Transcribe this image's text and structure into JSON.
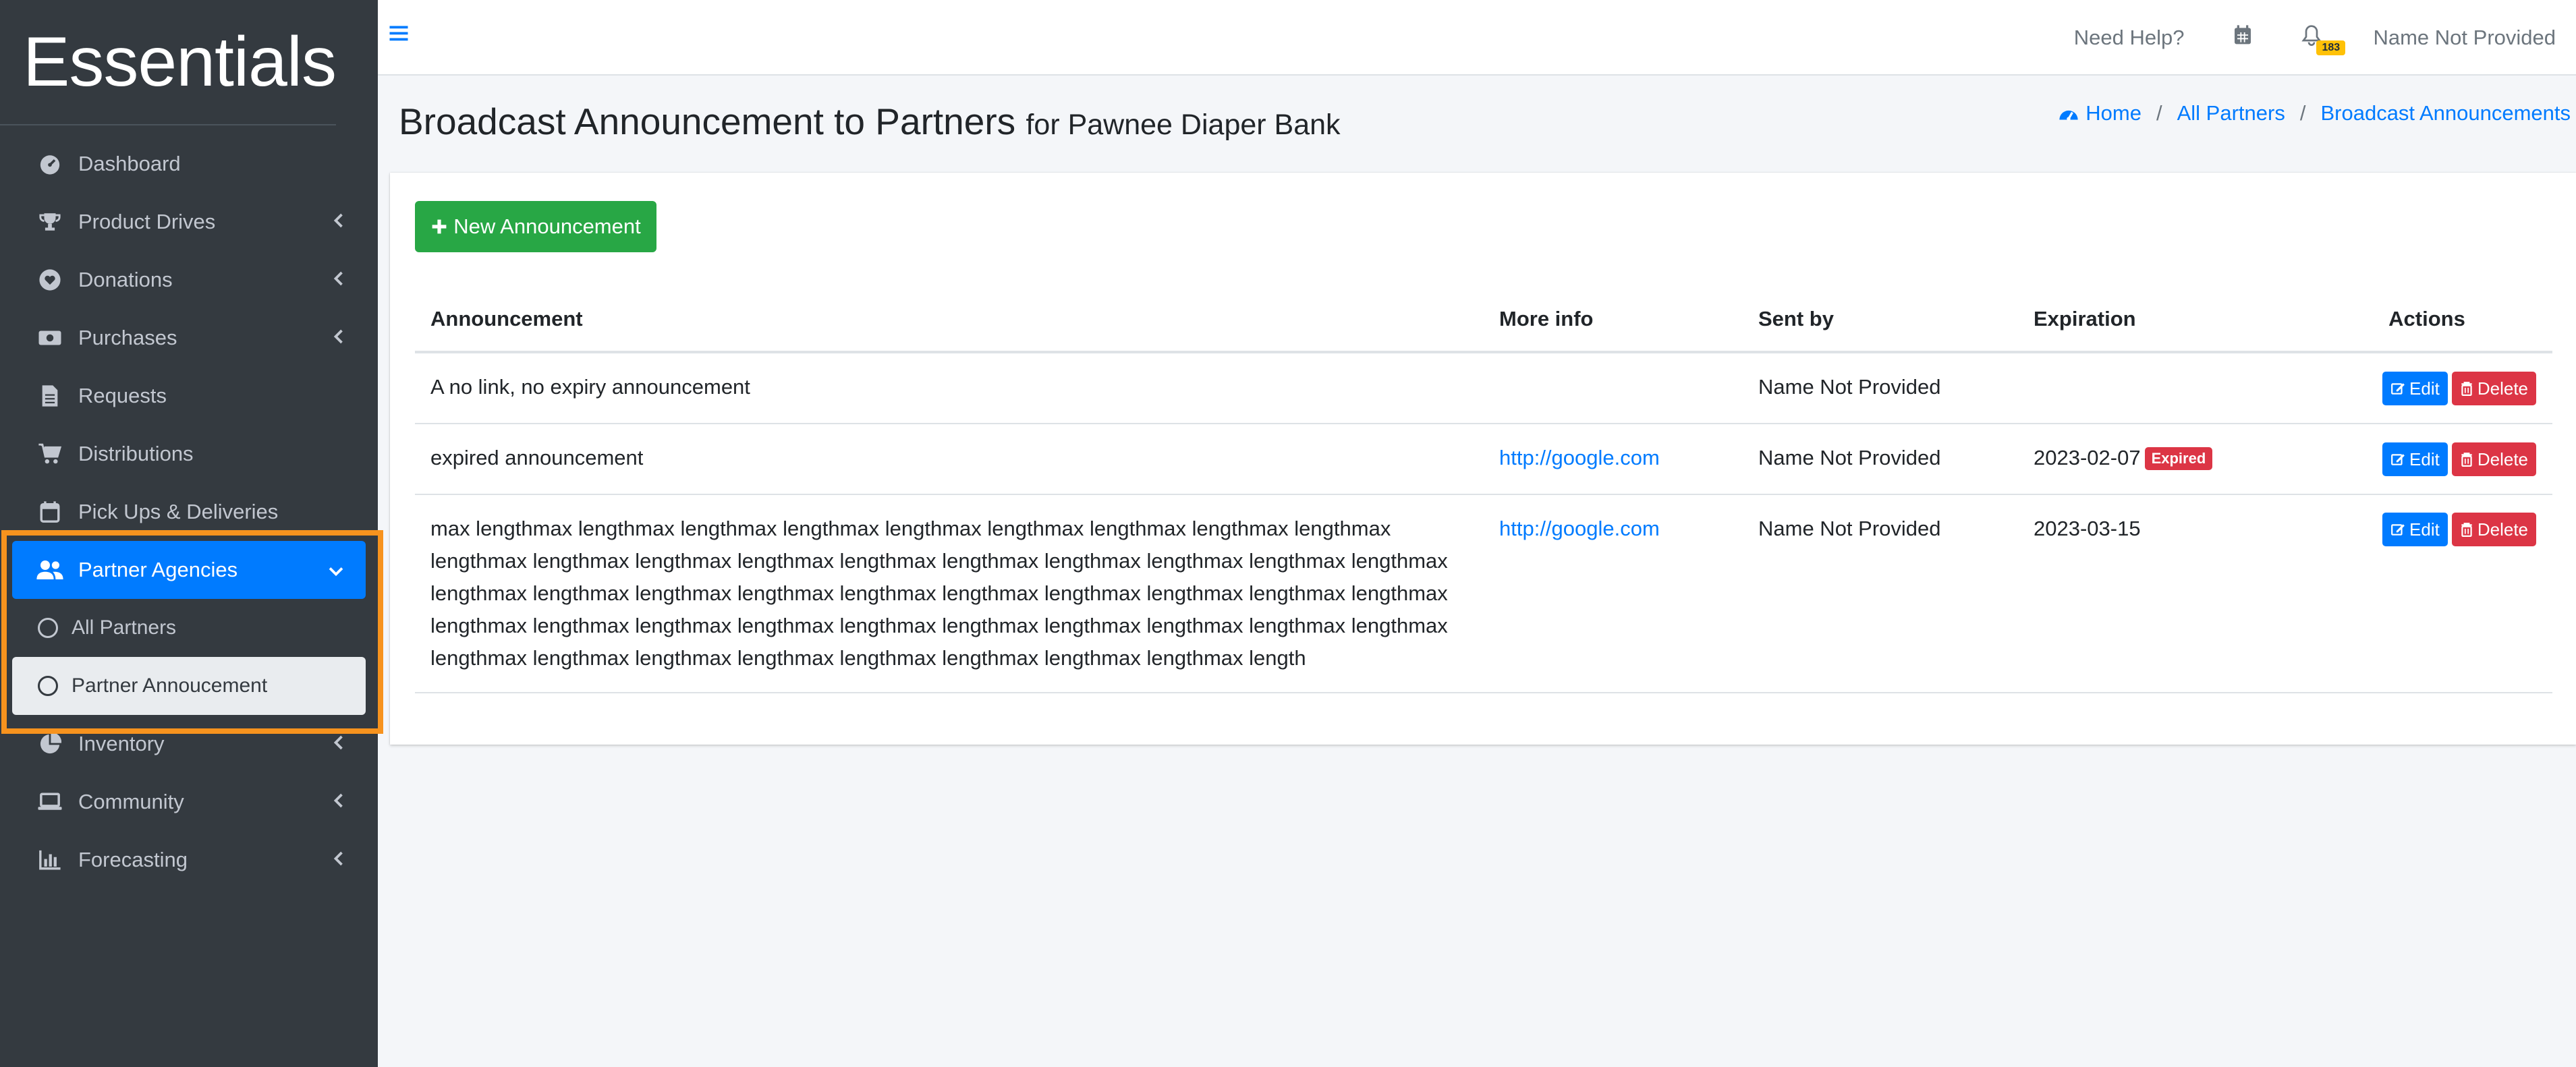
{
  "brand": "Essentials",
  "sidebar": {
    "items": [
      {
        "label": "Dashboard"
      },
      {
        "label": "Product Drives"
      },
      {
        "label": "Donations"
      },
      {
        "label": "Purchases"
      },
      {
        "label": "Requests"
      },
      {
        "label": "Distributions"
      },
      {
        "label": "Pick Ups & Deliveries"
      },
      {
        "label": "Partner Agencies"
      },
      {
        "label": "Inventory"
      },
      {
        "label": "Community"
      },
      {
        "label": "Forecasting"
      }
    ],
    "sub_items": [
      {
        "label": "All Partners"
      },
      {
        "label": "Partner Annoucement"
      }
    ]
  },
  "topbar": {
    "help": "Need Help?",
    "notification_count": "183",
    "user": "Name Not Provided"
  },
  "header": {
    "title": "Broadcast Announcement to Partners",
    "subtitle": "for Pawnee Diaper Bank",
    "breadcrumb": [
      "Home",
      "All Partners",
      "Broadcast Announcements"
    ]
  },
  "main": {
    "new_button": "New Announcement",
    "columns": [
      "Announcement",
      "More info",
      "Sent by",
      "Expiration",
      "Actions"
    ],
    "rows": [
      {
        "announcement": "A no link, no expiry announcement",
        "more_info": "",
        "sent_by": "Name Not Provided",
        "expiration": "",
        "expired_badge": ""
      },
      {
        "announcement": "expired announcement",
        "more_info": "http://google.com",
        "sent_by": "Name Not Provided",
        "expiration": "2023-02-07",
        "expired_badge": "Expired"
      },
      {
        "announcement": "max lengthmax lengthmax lengthmax lengthmax lengthmax lengthmax lengthmax lengthmax lengthmax lengthmax lengthmax lengthmax lengthmax lengthmax lengthmax lengthmax lengthmax lengthmax lengthmax lengthmax lengthmax lengthmax lengthmax lengthmax lengthmax lengthmax lengthmax lengthmax lengthmax lengthmax lengthmax lengthmax lengthmax lengthmax lengthmax lengthmax lengthmax lengthmax lengthmax lengthmax lengthmax lengthmax lengthmax lengthmax lengthmax lengthmax lengthmax length",
        "more_info": "http://google.com",
        "sent_by": "Name Not Provided",
        "expiration": "2023-03-15",
        "expired_badge": ""
      }
    ],
    "edit_label": "Edit",
    "delete_label": "Delete"
  },
  "colors": {
    "sidebar_bg": "#343a40",
    "primary": "#007bff",
    "success": "#28a745",
    "danger": "#dc3545",
    "highlight": "#f7931e"
  }
}
